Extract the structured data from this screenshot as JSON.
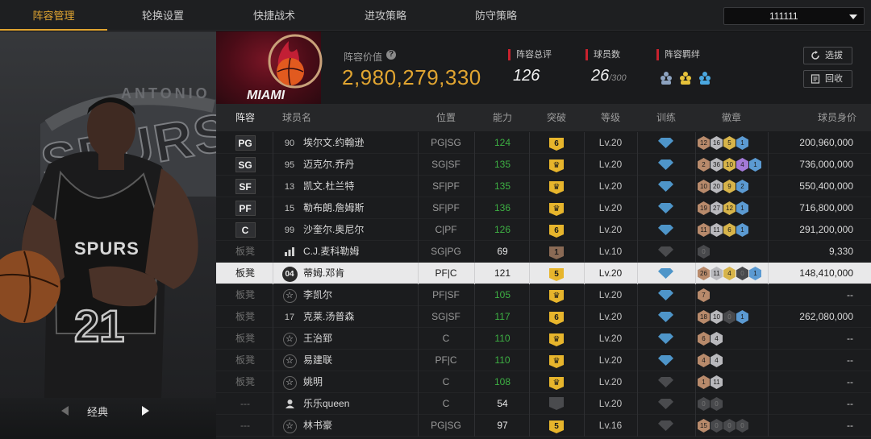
{
  "nav": {
    "tabs": [
      {
        "label": "阵容管理",
        "active": true
      },
      {
        "label": "轮换设置"
      },
      {
        "label": "快捷战术"
      },
      {
        "label": "进攻策略"
      },
      {
        "label": "防守策略"
      }
    ],
    "team_select": "111111"
  },
  "left_panel": {
    "card_type": "经典",
    "team_text": "ANTONIO",
    "team_word": "SPURS",
    "jersey_team": "SPURS",
    "jersey_number": "21"
  },
  "header": {
    "team_logo_text": "MIAMI",
    "lineup_value_label": "阵容价值",
    "lineup_value": "2,980,279,330",
    "rating_label": "阵容总评",
    "rating_value": "126",
    "players_label": "球员数",
    "players_value": "26",
    "players_max": "/300",
    "chemistry_label": "阵容羁绊",
    "sign_button": "选拔",
    "recycle_button": "回收"
  },
  "table": {
    "headers": {
      "lineup": "阵容",
      "name": "球员名",
      "position": "位置",
      "ability": "能力",
      "breakthrough": "突破",
      "level": "等级",
      "training": "训练",
      "badges": "徽章",
      "value": "球员身价"
    },
    "rows": [
      {
        "slot": "PG",
        "num": "90",
        "name": "埃尔文.约翰逊",
        "pos": "PG|SG",
        "ovr": "124",
        "brk": "6",
        "level": "Lv.20",
        "value": "200,960,000",
        "badges": [
          "12",
          "16",
          "5",
          "1"
        ]
      },
      {
        "slot": "SG",
        "num": "95",
        "name": "迈克尔.乔丹",
        "pos": "SG|SF",
        "ovr": "135",
        "brk": "♛",
        "level": "Lv.20",
        "value": "736,000,000",
        "badges": [
          "2",
          "36",
          "10",
          "4",
          "1"
        ]
      },
      {
        "slot": "SF",
        "num": "13",
        "name": "凯文.杜兰特",
        "pos": "SF|PF",
        "ovr": "135",
        "brk": "♛",
        "level": "Lv.20",
        "value": "550,400,000",
        "badges": [
          "10",
          "20",
          "9",
          "2"
        ]
      },
      {
        "slot": "PF",
        "num": "15",
        "name": "勒布朗.詹姆斯",
        "pos": "SF|PF",
        "ovr": "136",
        "brk": "♛",
        "level": "Lv.20",
        "value": "716,800,000",
        "badges": [
          "19",
          "27",
          "12",
          "1"
        ]
      },
      {
        "slot": "C",
        "num": "99",
        "name": "沙奎尔.奥尼尔",
        "pos": "C|PF",
        "ovr": "126",
        "brk": "6",
        "level": "Lv.20",
        "value": "291,200,000",
        "badges": [
          "11",
          "11",
          "6",
          "1"
        ]
      },
      {
        "slot": "板凳",
        "num": "",
        "name": "C.J.麦科勒姆",
        "pos": "SG|PG",
        "ovr": "69",
        "brk": "1",
        "level": "Lv.10",
        "value": "9,330",
        "badges": [
          "0"
        ]
      },
      {
        "slot": "板凳",
        "num": "04",
        "name": "蒂姆.邓肯",
        "pos": "PF|C",
        "ovr": "121",
        "brk": "5",
        "level": "Lv.20",
        "value": "148,410,000",
        "badges": [
          "26",
          "11",
          "4",
          "0",
          "1"
        ]
      },
      {
        "slot": "板凳",
        "num": "",
        "name": "李凯尔",
        "pos": "PF|SF",
        "ovr": "105",
        "brk": "♛",
        "level": "Lv.20",
        "value": "--",
        "badges": [
          "7"
        ]
      },
      {
        "slot": "板凳",
        "num": "17",
        "name": "克莱.汤普森",
        "pos": "SG|SF",
        "ovr": "117",
        "brk": "6",
        "level": "Lv.20",
        "value": "262,080,000",
        "badges": [
          "18",
          "10",
          "0",
          "1"
        ]
      },
      {
        "slot": "板凳",
        "num": "",
        "name": "王治郅",
        "pos": "C",
        "ovr": "110",
        "brk": "♛",
        "level": "Lv.20",
        "value": "--",
        "badges": [
          "6",
          "4"
        ]
      },
      {
        "slot": "板凳",
        "num": "",
        "name": "易建联",
        "pos": "PF|C",
        "ovr": "110",
        "brk": "♛",
        "level": "Lv.20",
        "value": "--",
        "badges": [
          "4",
          "4"
        ]
      },
      {
        "slot": "板凳",
        "num": "",
        "name": "姚明",
        "pos": "C",
        "ovr": "108",
        "brk": "♛",
        "level": "Lv.20",
        "value": "--",
        "badges": [
          "1",
          "11"
        ]
      },
      {
        "slot": "---",
        "num": "",
        "name": "乐乐queen",
        "pos": "C",
        "ovr": "54",
        "brk": "",
        "level": "Lv.20",
        "value": "--",
        "badges": [
          "0",
          "0"
        ]
      },
      {
        "slot": "---",
        "num": "",
        "name": "林书豪",
        "pos": "PG|SG",
        "ovr": "97",
        "brk": "5",
        "level": "Lv.16",
        "value": "--",
        "badges": [
          "15",
          "0",
          "0",
          "0"
        ]
      }
    ]
  }
}
